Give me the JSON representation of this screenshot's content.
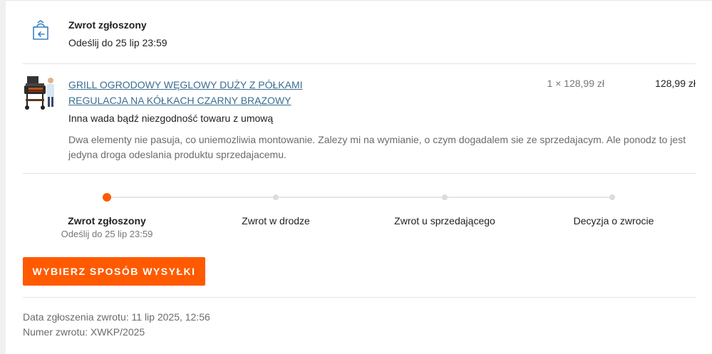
{
  "status": {
    "icon": "return-box-icon",
    "title": "Zwrot zgłoszony",
    "deadline": "Odeślij do 25 lip 23:59"
  },
  "item": {
    "name_line1": "GRILL OGRODOWY WĘGLOWY DUŻY Z PÓŁKAMI",
    "name_line2": "REGULACJA NA KÓŁKACH CZARNY BRĄZOWY",
    "quantity_price": "1 × 128,99 zł",
    "total": "128,99 zł",
    "reason": "Inna wada bądź niezgodność towaru z umową",
    "description": "Dwa elementy nie pasuja, co uniemozliwia montowanie. Zalezy mi na wymianie, o czym dogadalem sie ze sprzedajacym. Ale ponodz to jest jedyna droga odeslania produktu sprzedajacemu."
  },
  "progress": {
    "current_step": 1,
    "steps": [
      {
        "label": "Zwrot zgłoszony",
        "sub": "Odeślij do 25 lip 23:59",
        "bold": true
      },
      {
        "label": "Zwrot w drodze",
        "sub": ""
      },
      {
        "label": "Zwrot u sprzedającego",
        "sub": ""
      },
      {
        "label": "Decyzja o zwrocie",
        "sub": ""
      }
    ]
  },
  "cta": {
    "label": "WYBIERZ SPOSÓB WYSYŁKI"
  },
  "meta": {
    "date_line": "Data zgłoszenia zwrotu: 11 lip 2025, 12:56",
    "number_line": "Numer zwrotu: XWKP/2025"
  },
  "colors": {
    "accent": "#ff5a00",
    "link": "#3b6e8f",
    "icon": "#3b82c4"
  }
}
